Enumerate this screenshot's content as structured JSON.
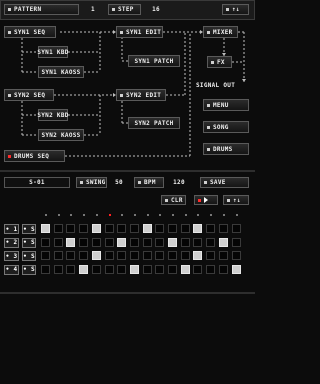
{
  "header": {
    "pattern_label": "PATTERN",
    "pattern_value": "1",
    "step_label": "STEP",
    "step_value": "16",
    "arrows": "↑↓"
  },
  "routing": {
    "synth1_seq": "SYN1 SEQ",
    "synth1_kbd": "SYN1 KBD",
    "synth1_kaoss": "SYN1 KAOSS",
    "synth1_edit": "SYN1 EDIT",
    "synth1_patch": "SYN1 PATCH",
    "synth2_seq": "SYN2 SEQ",
    "synth2_kbd": "SYN2 KBD",
    "synth2_kaoss": "SYN2 KAOSS",
    "synth2_edit": "SYN2 EDIT",
    "synth2_patch": "SYN2 PATCH",
    "drums_seq": "DRUMS SEQ",
    "mixer": "MIXER",
    "fx": "FX",
    "signal_out": "SIGNAL OUT",
    "menu": "MENU",
    "song": "SONG",
    "drums": "DRUMS"
  },
  "transport": {
    "song_slot": "S-01",
    "swing_label": "SWING",
    "swing_value": "50",
    "bpm_label": "BPM",
    "bpm_value": "120",
    "save_label": "SAVE"
  },
  "pattern_tools": {
    "clr_label": "CLR",
    "arrows": "↑↓"
  },
  "sequencer": {
    "playhead_step": 5,
    "rows": [
      {
        "num": "1",
        "solo": "S",
        "steps": [
          1,
          0,
          0,
          0,
          1,
          0,
          0,
          0,
          1,
          0,
          0,
          0,
          1,
          0,
          0,
          0
        ]
      },
      {
        "num": "2",
        "solo": "S",
        "steps": [
          0,
          0,
          1,
          0,
          0,
          0,
          1,
          0,
          0,
          0,
          1,
          0,
          0,
          0,
          1,
          0
        ]
      },
      {
        "num": "3",
        "solo": "S",
        "steps": [
          0,
          0,
          0,
          0,
          1,
          0,
          0,
          0,
          0,
          0,
          0,
          0,
          1,
          0,
          0,
          0
        ]
      },
      {
        "num": "4",
        "solo": "S",
        "steps": [
          0,
          0,
          0,
          1,
          0,
          0,
          0,
          1,
          0,
          0,
          0,
          1,
          0,
          0,
          0,
          1
        ]
      }
    ]
  },
  "colors": {
    "active_led": "#ff2a2a",
    "background": "#0c0c0c",
    "step_on": "#cfcfcf"
  }
}
